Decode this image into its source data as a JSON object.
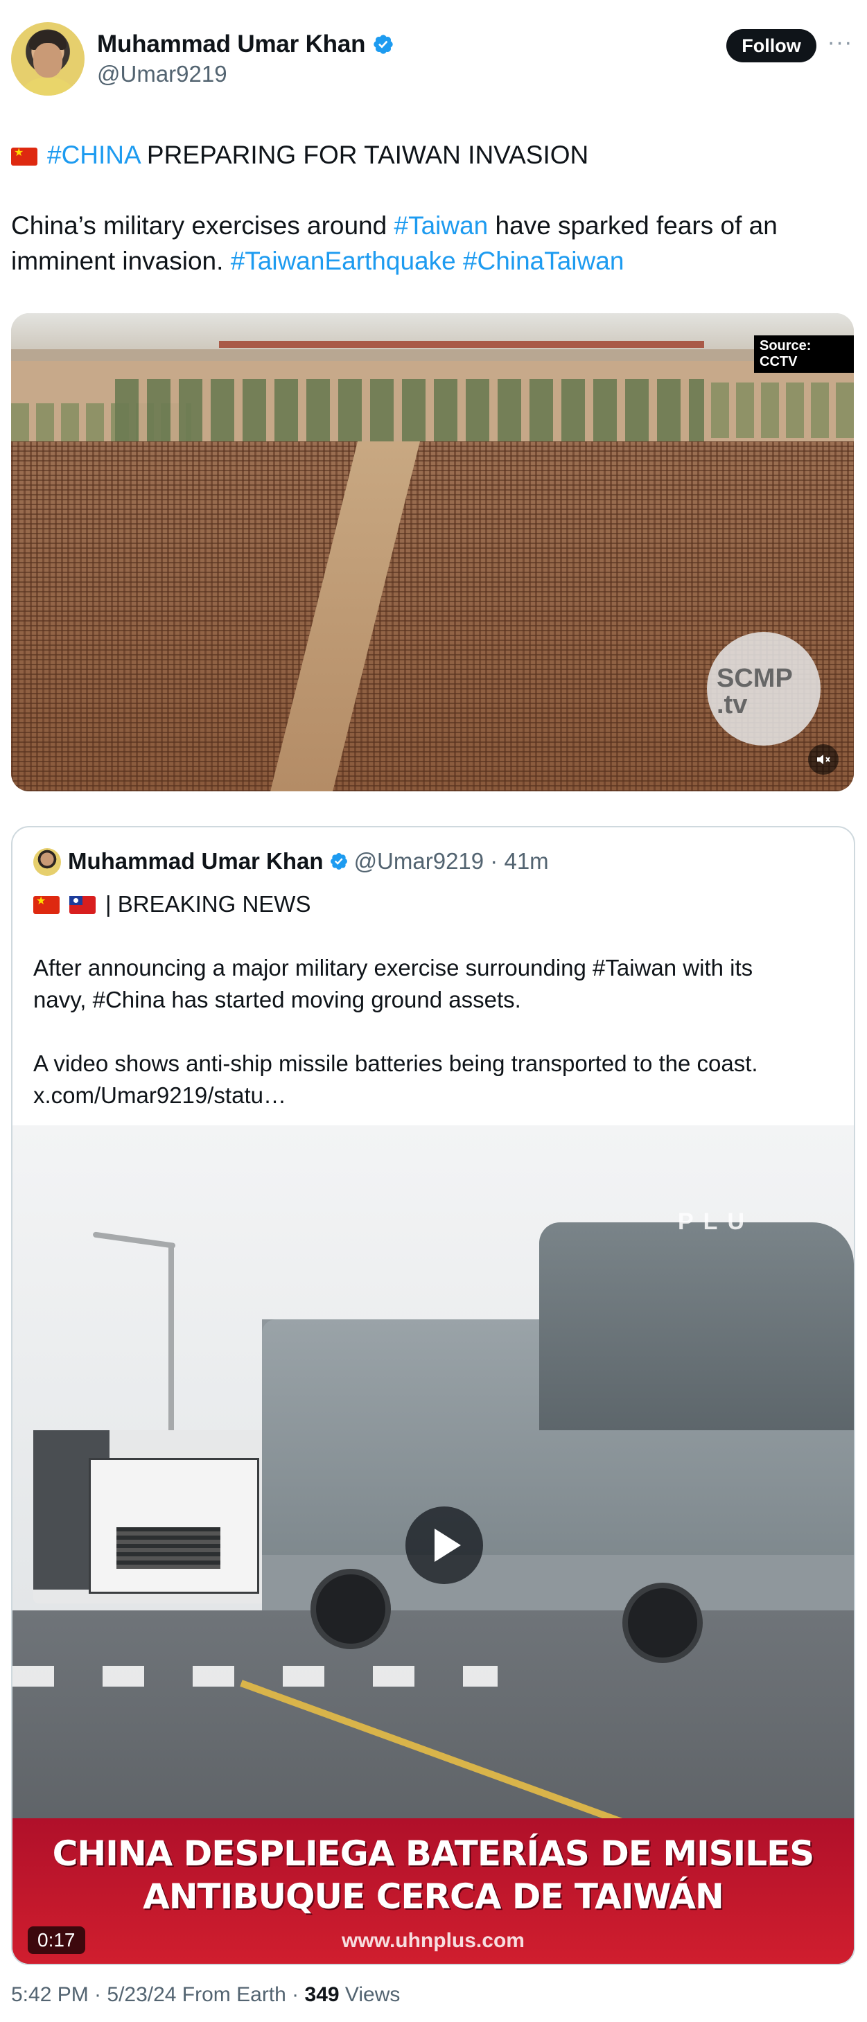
{
  "author": {
    "name": "Muhammad Umar Khan",
    "handle": "@Umar9219",
    "follow_label": "Follow",
    "more_icon": "more-horizontal-icon"
  },
  "post": {
    "headline_hashtag": "#CHINA",
    "headline_text": " PREPARING FOR TAIWAN INVASION",
    "body_part1": "China’s military exercises around ",
    "body_tag1": "#Taiwan",
    "body_part2": " have sparked fears of an",
    "body_part3": "imminent invasion. ",
    "body_tag2": "#TaiwanEarthquake",
    "body_tag3": " #ChinaTaiwan"
  },
  "media1": {
    "source_label": "Source: CCTV",
    "watermark_line1": "SCMP",
    "watermark_line2": ".tv",
    "mute_icon": "speaker-muted-icon"
  },
  "quote": {
    "name": "Muhammad Umar Khan",
    "meta": "@Umar9219 · 41m",
    "breaking": "| BREAKING NEWS",
    "line1": "After announcing a major military exercise surrounding #Taiwan with its",
    "line2": "navy, #China has started moving ground assets.",
    "line3": "A video shows anti-ship missile batteries being transported to the coast.",
    "link": "x.com/Umar9219/statu…",
    "video": {
      "caption_line1": "CHINA DESPLIEGA BATERÍAS DE MISILES",
      "caption_line2": "ANTIBUQUE CERCA DE TAIWÁN",
      "caption_url": "www.uhnplus.com",
      "corner_mark": "PLU",
      "duration": "0:17"
    }
  },
  "footer": {
    "time": "5:42 PM · 5/23/24 From Earth · ",
    "views_count": "349",
    "views_label": " Views"
  },
  "colors": {
    "accent": "#1d9bf0",
    "text": "#0f1419",
    "secondary": "#536471"
  }
}
